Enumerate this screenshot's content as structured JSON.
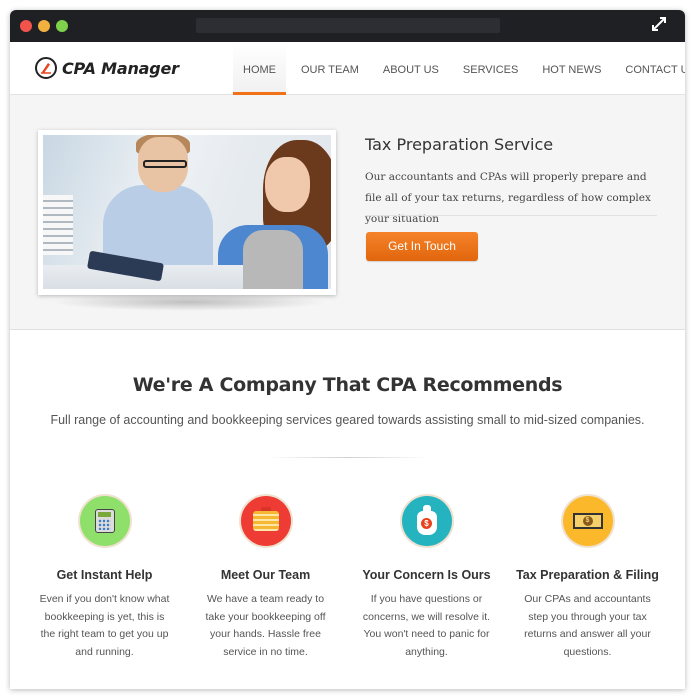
{
  "window": {
    "traffic_lights": [
      "close",
      "minimize",
      "maximize"
    ],
    "expand_icon": "expand-arrows-icon"
  },
  "brand": {
    "name": "CPA Manager",
    "logo_icon": "pen-circle-icon",
    "accent_color": "#f07117"
  },
  "nav": {
    "items": [
      {
        "label": "HOME",
        "active": true
      },
      {
        "label": "OUR TEAM",
        "active": false
      },
      {
        "label": "ABOUT US",
        "active": false
      },
      {
        "label": "SERVICES",
        "active": false
      },
      {
        "label": "HOT NEWS",
        "active": false
      },
      {
        "label": "CONTACT US",
        "active": false
      }
    ]
  },
  "hero": {
    "image_alt": "Two accountants reviewing documents with a calculator",
    "title": "Tax Preparation Service",
    "text": "Our accountants and CPAs will properly prepare and file all of your tax returns, regardless of how complex your situation",
    "button_label": "Get In Touch"
  },
  "intro": {
    "title": "We're A Company That CPA Recommends",
    "subtitle": "Full range of accounting and bookkeeping services geared towards assisting small to mid-sized companies."
  },
  "features": [
    {
      "icon": "calculator-icon",
      "icon_bg": "#8ee06a",
      "title": "Get Instant Help",
      "text": "Even if you don't know what bookkeeping is yet, this is the right team to get you up and running."
    },
    {
      "icon": "briefcase-icon",
      "icon_bg": "#ee3b33",
      "title": "Meet Our Team",
      "text": "We have a team ready to take your bookkeeping off your hands. Hassle free service in no time."
    },
    {
      "icon": "money-bag-icon",
      "icon_bg": "#26b3c0",
      "title": "Your Concern Is Ours",
      "text": "If you have questions or concerns, we will resolve it. You won't need to panic for anything.",
      "glyph": "$"
    },
    {
      "icon": "banknote-icon",
      "icon_bg": "#fbb82b",
      "title": "Tax Preparation & Filing",
      "text": "Our CPAs and accountants step you through your tax returns and answer all your questions.",
      "glyph": "$"
    }
  ]
}
